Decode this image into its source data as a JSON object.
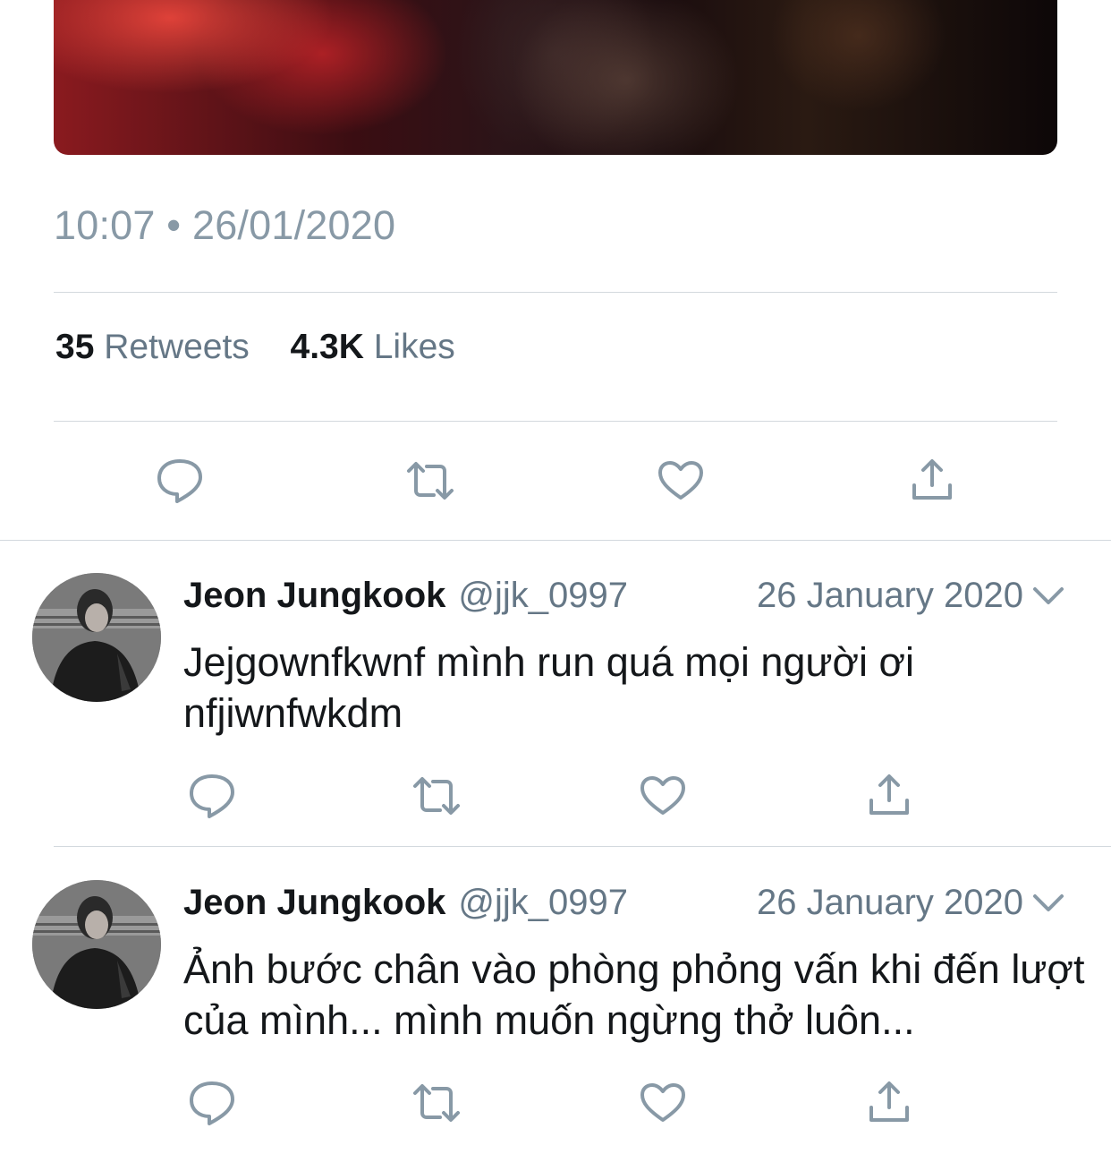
{
  "main_tweet": {
    "timestamp": "10:07 • 26/01/2020",
    "retweets_count": "35",
    "retweets_label": "Retweets",
    "likes_count": "4.3K",
    "likes_label": "Likes"
  },
  "replies": [
    {
      "name": "Jeon Jungkook",
      "handle": "@jjk_0997",
      "date": "26 January 2020",
      "text": "Jejgownfkwnf mình run quá mọi người ơi nfjiwnfwkdm"
    },
    {
      "name": "Jeon Jungkook",
      "handle": "@jjk_0997",
      "date": "26 January 2020",
      "text": "Ảnh bước chân vào phòng phỏng vấn khi đến lượt của mình... mình muốn ngừng thở luôn..."
    }
  ],
  "icons": [
    "reply-icon",
    "retweet-icon",
    "like-icon",
    "share-icon",
    "chevron-down-icon"
  ],
  "colors": {
    "text_primary": "#14171a",
    "text_secondary": "#657786",
    "icon_gray": "#8899a6",
    "divider": "#d3d9de"
  }
}
